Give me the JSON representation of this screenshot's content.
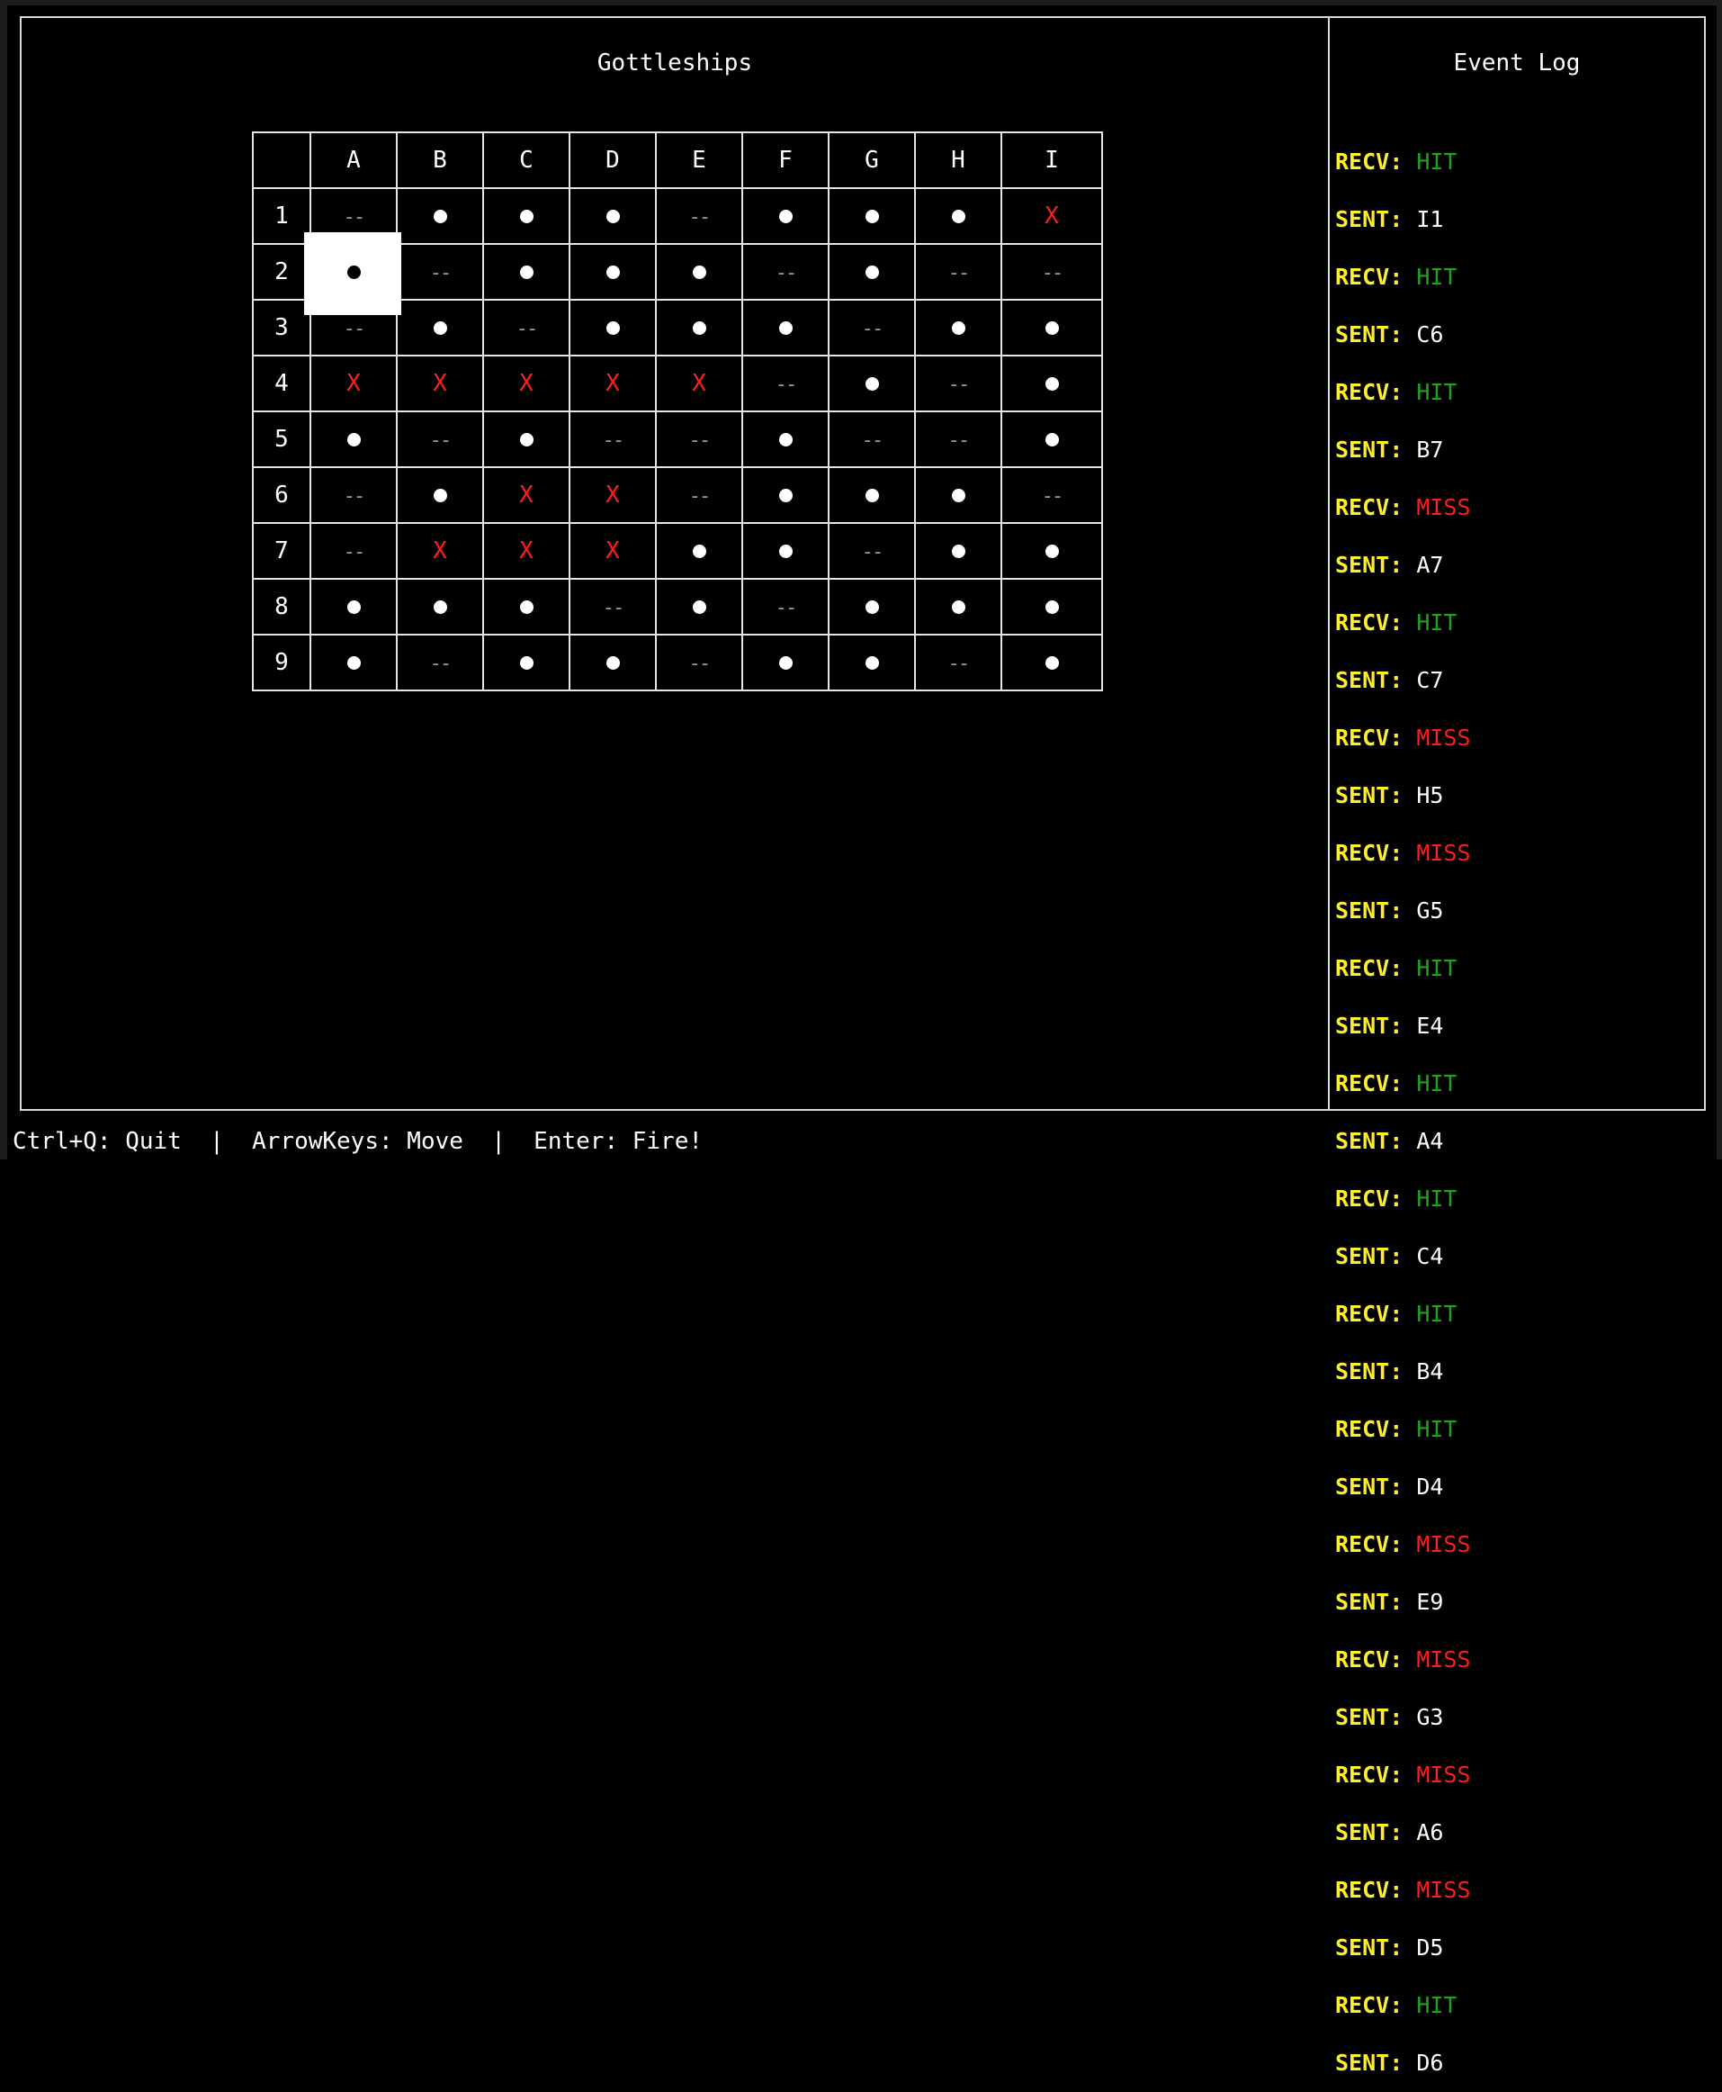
{
  "game": {
    "title": "Gottleships",
    "columns": [
      "A",
      "B",
      "C",
      "D",
      "E",
      "F",
      "G",
      "H",
      "I"
    ],
    "rows": [
      "1",
      "2",
      "3",
      "4",
      "5",
      "6",
      "7",
      "8",
      "9"
    ],
    "grid": [
      [
        "water",
        "ship",
        "ship",
        "ship",
        "water",
        "ship",
        "ship",
        "ship",
        "hit"
      ],
      [
        "ship",
        "water",
        "ship",
        "ship",
        "ship",
        "water",
        "ship",
        "water",
        "water"
      ],
      [
        "water",
        "ship",
        "water",
        "ship",
        "ship",
        "ship",
        "water",
        "ship",
        "ship"
      ],
      [
        "hit",
        "hit",
        "hit",
        "hit",
        "hit",
        "water",
        "ship",
        "water",
        "ship"
      ],
      [
        "ship",
        "water",
        "ship",
        "water",
        "water",
        "ship",
        "water",
        "water",
        "ship"
      ],
      [
        "water",
        "ship",
        "hit",
        "hit",
        "water",
        "ship",
        "ship",
        "ship",
        "water"
      ],
      [
        "water",
        "hit",
        "hit",
        "hit",
        "ship",
        "ship",
        "water",
        "ship",
        "ship"
      ],
      [
        "ship",
        "ship",
        "ship",
        "water",
        "ship",
        "water",
        "ship",
        "ship",
        "ship"
      ],
      [
        "ship",
        "water",
        "ship",
        "ship",
        "water",
        "ship",
        "ship",
        "water",
        "ship"
      ]
    ],
    "symbols": {
      "water": "--",
      "hit": "X",
      "ship": ""
    },
    "selected_cell": "A2"
  },
  "event_log": {
    "title": "Event Log",
    "entries": [
      {
        "kind": "RECV:",
        "value": "HIT",
        "status": "hit"
      },
      {
        "kind": "SENT:",
        "value": "I1",
        "status": "sent"
      },
      {
        "kind": "RECV:",
        "value": "HIT",
        "status": "hit"
      },
      {
        "kind": "SENT:",
        "value": "C6",
        "status": "sent"
      },
      {
        "kind": "RECV:",
        "value": "HIT",
        "status": "hit"
      },
      {
        "kind": "SENT:",
        "value": "B7",
        "status": "sent"
      },
      {
        "kind": "RECV:",
        "value": "MISS",
        "status": "miss"
      },
      {
        "kind": "SENT:",
        "value": "A7",
        "status": "sent"
      },
      {
        "kind": "RECV:",
        "value": "HIT",
        "status": "hit"
      },
      {
        "kind": "SENT:",
        "value": "C7",
        "status": "sent"
      },
      {
        "kind": "RECV:",
        "value": "MISS",
        "status": "miss"
      },
      {
        "kind": "SENT:",
        "value": "H5",
        "status": "sent"
      },
      {
        "kind": "RECV:",
        "value": "MISS",
        "status": "miss"
      },
      {
        "kind": "SENT:",
        "value": "G5",
        "status": "sent"
      },
      {
        "kind": "RECV:",
        "value": "HIT",
        "status": "hit"
      },
      {
        "kind": "SENT:",
        "value": "E4",
        "status": "sent"
      },
      {
        "kind": "RECV:",
        "value": "HIT",
        "status": "hit"
      },
      {
        "kind": "SENT:",
        "value": "A4",
        "status": "sent"
      },
      {
        "kind": "RECV:",
        "value": "HIT",
        "status": "hit"
      },
      {
        "kind": "SENT:",
        "value": "C4",
        "status": "sent"
      },
      {
        "kind": "RECV:",
        "value": "HIT",
        "status": "hit"
      },
      {
        "kind": "SENT:",
        "value": "B4",
        "status": "sent"
      },
      {
        "kind": "RECV:",
        "value": "HIT",
        "status": "hit"
      },
      {
        "kind": "SENT:",
        "value": "D4",
        "status": "sent"
      },
      {
        "kind": "RECV:",
        "value": "MISS",
        "status": "miss"
      },
      {
        "kind": "SENT:",
        "value": "E9",
        "status": "sent"
      },
      {
        "kind": "RECV:",
        "value": "MISS",
        "status": "miss"
      },
      {
        "kind": "SENT:",
        "value": "G3",
        "status": "sent"
      },
      {
        "kind": "RECV:",
        "value": "MISS",
        "status": "miss"
      },
      {
        "kind": "SENT:",
        "value": "A6",
        "status": "sent"
      },
      {
        "kind": "RECV:",
        "value": "MISS",
        "status": "miss"
      },
      {
        "kind": "SENT:",
        "value": "D5",
        "status": "sent"
      },
      {
        "kind": "RECV:",
        "value": "HIT",
        "status": "hit"
      },
      {
        "kind": "SENT:",
        "value": "D6",
        "status": "sent"
      }
    ]
  },
  "footer": {
    "text": "Ctrl+Q: Quit  |  ArrowKeys: Move  |  Enter: Fire!"
  },
  "colors": {
    "background": "#000000",
    "border": "#d8d8d8",
    "label_yellow": "#ffee2a",
    "hit_green": "#1aa61a",
    "miss_red": "#ff1d1d",
    "water_gray": "#9a9a9a"
  }
}
